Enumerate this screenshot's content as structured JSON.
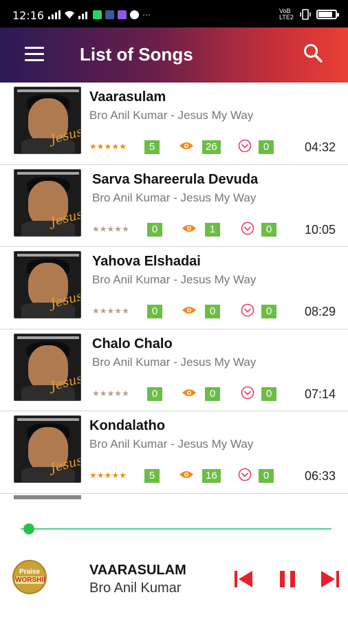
{
  "status_bar": {
    "time": "12:16",
    "right_text": "VoB LTE2",
    "battery_level": 0.85
  },
  "header": {
    "title": "List of Songs",
    "menu_icon": "menu-icon",
    "search_icon": "search-icon"
  },
  "colors": {
    "header_gradient_start": "#2a1a55",
    "header_gradient_end": "#e84035",
    "badge_green": "#6cbd45",
    "icon_orange": "#ef8a1c",
    "heart_pink": "#e8406a",
    "star_filled": "#ef8a1c",
    "star_empty": "#b8a08a",
    "progress_green": "#27c24c",
    "control_red": "#e8202a"
  },
  "songs": [
    {
      "title": "Vaarasulam",
      "artist": "Bro Anil Kumar - Jesus My Way",
      "rating_filled": 5,
      "rating_count": "5",
      "views": "26",
      "likes": "0",
      "duration": "04:32"
    },
    {
      "title": "Sarva Shareerula Devuda",
      "artist": "Bro Anil Kumar - Jesus My Way",
      "rating_filled": 0,
      "rating_count": "0",
      "views": "1",
      "likes": "0",
      "duration": "10:05"
    },
    {
      "title": "Yahova Elshadai",
      "artist": "Bro Anil Kumar - Jesus My Way",
      "rating_filled": 0,
      "rating_count": "0",
      "views": "0",
      "likes": "0",
      "duration": "08:29"
    },
    {
      "title": "Chalo Chalo",
      "artist": "Bro Anil Kumar - Jesus My Way",
      "rating_filled": 0,
      "rating_count": "0",
      "views": "0",
      "likes": "0",
      "duration": "07:14"
    },
    {
      "title": "Kondalatho",
      "artist": "Bro Anil Kumar - Jesus My Way",
      "rating_filled": 5,
      "rating_count": "5",
      "views": "16",
      "likes": "0",
      "duration": "06:33"
    }
  ],
  "player": {
    "progress": 0.02,
    "now_playing_title": "VAARASULAM",
    "now_playing_artist": "Bro Anil Kumar",
    "logo_text_top": "Praise",
    "logo_text_main": "WORSHIP",
    "controls": [
      "skip-previous-icon",
      "pause-icon",
      "skip-next-icon"
    ]
  }
}
